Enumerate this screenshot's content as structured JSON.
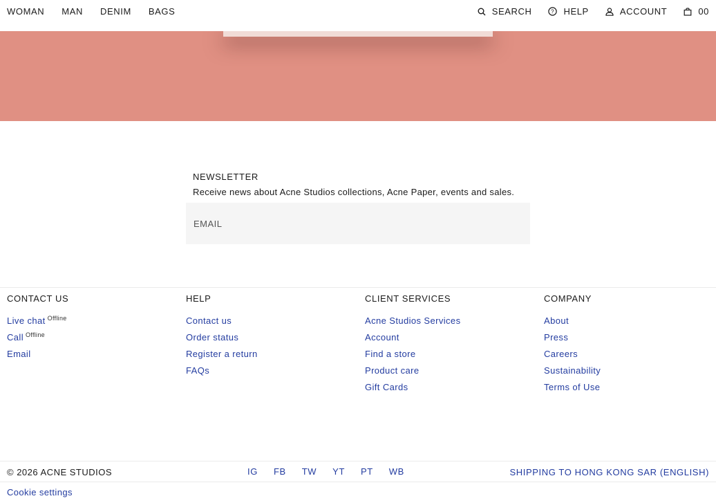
{
  "nav": {
    "left": [
      "WOMAN",
      "MAN",
      "DENIM",
      "BAGS"
    ],
    "search": "SEARCH",
    "help": "HELP",
    "account": "ACCOUNT",
    "cart_count": "00"
  },
  "hero": {
    "color": "#e09083"
  },
  "newsletter": {
    "title": "NEWSLETTER",
    "description": "Receive news about Acne Studios collections, Acne Paper, events and sales.",
    "email_placeholder": "EMAIL"
  },
  "footer": {
    "contact": {
      "heading": "CONTACT US",
      "items": [
        {
          "label": "Live chat",
          "status": "Offline"
        },
        {
          "label": "Call",
          "status": "Offline"
        },
        {
          "label": "Email"
        }
      ]
    },
    "help": {
      "heading": "HELP",
      "items": [
        "Contact us",
        "Order status",
        "Register a return",
        "FAQs"
      ]
    },
    "client_services": {
      "heading": "CLIENT SERVICES",
      "items": [
        "Acne Studios Services",
        "Account",
        "Find a store",
        "Product care",
        "Gift Cards"
      ]
    },
    "company": {
      "heading": "COMPANY",
      "items": [
        "About",
        "Press",
        "Careers",
        "Sustainability",
        "Terms of Use"
      ]
    }
  },
  "bottom": {
    "copyright": "© 2026 ACNE STUDIOS",
    "socials": [
      "IG",
      "FB",
      "TW",
      "YT",
      "PT",
      "WB"
    ],
    "shipping": "SHIPPING TO HONG KONG SAR (ENGLISH)",
    "cookie": "Cookie settings"
  },
  "colors": {
    "link": "#233ca0",
    "text": "#1a1a1a"
  }
}
